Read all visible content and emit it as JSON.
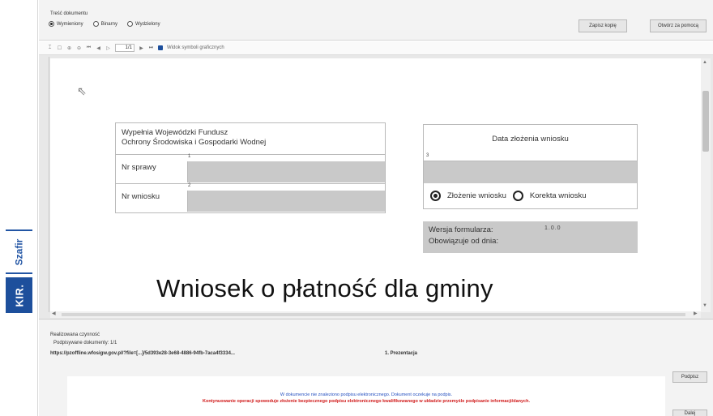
{
  "top": {
    "group_label": "Treść dokumentu",
    "radios": [
      {
        "label": "Wymieniony",
        "selected": true
      },
      {
        "label": "Binarny",
        "selected": false
      },
      {
        "label": "Wydzielony",
        "selected": false
      }
    ],
    "save_button": "Zapisz kopię",
    "open_button": "Otwórz za pomocą"
  },
  "toolbar": {
    "page_value": "1/1",
    "mode_label": "Widok symboli graficznych"
  },
  "form": {
    "fund_line1": "Wypełnia Wojewódzki Fundusz",
    "fund_line2": "Ochrony Środowiska i Gospodarki Wodnej",
    "case_label": "Nr sprawy",
    "case_num": "1",
    "app_label": "Nr wniosku",
    "app_num": "2",
    "date_title": "Data złożenia wniosku",
    "date_num": "3",
    "opt_submit": "Złożenie wniosku",
    "opt_correct": "Korekta wniosku",
    "version_label": "Wersja formularza:",
    "version_value": "1.0.0",
    "valid_label": "Obowiązuje od dnia:",
    "title": "Wniosek o płatność dla gminy"
  },
  "bottom": {
    "action_label": "Realizowana czynność",
    "signed_label": "Podpisywane dokumenty: 1/1",
    "url": "https://pzoffline.wfosigw.gov.pl/?file=[...]/5d393e28-3e68-4886-94fb-7aca4f3334...",
    "section": "1. Prezentacja",
    "sign_blue": "W dokumencie nie znaleziono podpisu elektronicznego. Dokument oczekuje na podpis.",
    "sign_red": "Kontynuowanie operacji spowoduje złożenie bezpiecznego podpisu elektronicznego kwalifikowanego w układzie przemyśle podpisanie informacji/danych.",
    "sign_button": "Podpisz",
    "next_button": "Dalej"
  },
  "brand": {
    "app_name": "Szafir",
    "logo": "KIR."
  }
}
